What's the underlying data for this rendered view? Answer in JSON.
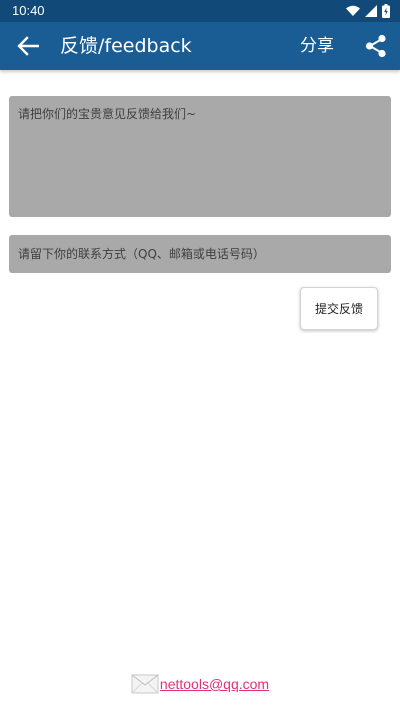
{
  "status_bar": {
    "time": "10:40",
    "icons": [
      "wifi-icon",
      "signal-icon",
      "battery-icon"
    ]
  },
  "app_bar": {
    "title": "反馈/feedback",
    "share_label": "分享",
    "icons": [
      "back-arrow-icon",
      "share-icon"
    ],
    "background_color": "#1a5d95",
    "status_color": "#114a78"
  },
  "form": {
    "feedback_placeholder": "请把你们的宝贵意见反馈给我们~",
    "contact_placeholder": "请留下你的联系方式（QQ、邮箱或电话号码）",
    "submit_label": "提交反馈",
    "field_color": "#a9a9a9"
  },
  "footer": {
    "email": "nettools@qq.com",
    "icon": "envelope-icon",
    "link_color": "#e2307a"
  }
}
